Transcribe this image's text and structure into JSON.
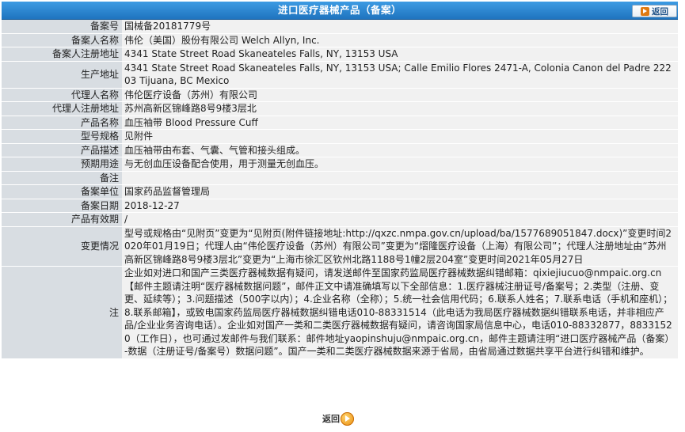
{
  "header": {
    "title": "进口医疗器械产品（备案）",
    "back_label": "返回"
  },
  "rows": [
    {
      "label": "备案号",
      "value": "国械备20181779号"
    },
    {
      "label": "备案人名称",
      "value": "伟伦（美国）股份有限公司 Welch Allyn, Inc."
    },
    {
      "label": "备案人注册地址",
      "value": "4341 State Street Road Skaneateles Falls, NY, 13153 USA"
    },
    {
      "label": "生产地址",
      "value": "4341 State Street Road Skaneateles Falls, NY, 13153 USA; Calle Emilio Flores 2471-A, Colonia Canon del Padre 22203 Tijuana, BC Mexico"
    },
    {
      "label": "代理人名称",
      "value": "伟伦医疗设备（苏州）有限公司"
    },
    {
      "label": "代理人注册地址",
      "value": "苏州高新区锦峰路8号9楼3层北"
    },
    {
      "label": "产品名称",
      "value": "血压袖带 Blood Pressure Cuff"
    },
    {
      "label": "型号规格",
      "value": "见附件"
    },
    {
      "label": "产品描述",
      "value": "血压袖带由布套、气囊、气管和接头组成。"
    },
    {
      "label": "预期用途",
      "value": "与无创血压设备配合使用，用于测量无创血压。"
    },
    {
      "label": "备注",
      "value": ""
    },
    {
      "label": "备案单位",
      "value": "国家药品监督管理局"
    },
    {
      "label": "备案日期",
      "value": "2018-12-27"
    },
    {
      "label": "产品有效期",
      "value": "/"
    },
    {
      "label": "变更情况",
      "value": "型号或规格由“见附页”变更为“见附页(附件链接地址:http://qxzc.nmpa.gov.cn/upload/ba/1577689051847.docx)”变更时间2020年01月19日；代理人由“伟伦医疗设备（苏州）有限公司”变更为“熠隆医疗设备（上海）有限公司”；代理人注册地址由“苏州高新区锦峰路8号9楼3层北”变更为“上海市徐汇区钦州北路1188号1幢2层204室”变更时间2021年05月27日"
    },
    {
      "label": "注",
      "value": "企业如对进口和国产三类医疗器械数据有疑问，请发送邮件至国家药监局医疗器械数据纠错邮箱：qixiejiucuo@nmpaic.org.cn【邮件主题请注明“医疗器械数据问题”，邮件正文中请准确填写以下全部信息：1.医疗器械注册证号/备案号；2.类型（注册、变更、延续等）；3.问题描述（500字以内）；4.企业名称（全称）；5.统一社会信用代码；6.联系人姓名；7.联系电话（手机和座机）；8.联系邮箱】，或致电国家药监局医疗器械数据纠错电话010-88331514（此电话为我局医疗器械数据纠错联系电话，并非相应产品/企业业务咨询电话）。企业如对国产一类和二类医疗器械数据有疑问，请咨询国家局信息中心，电话010-88332877，88331520（工作日），也可通过发邮件与我们联系：邮件地址yaopinshuju@nmpaic.org.cn，邮件主题请注明“进口医疗器械产品（备案）-数据（注册证号/备案号）数据问题”。国产一类和二类医疗器械数据来源于省局，由省局通过数据共享平台进行纠错和维护。"
    }
  ],
  "footer": {
    "back_label": "返回"
  }
}
